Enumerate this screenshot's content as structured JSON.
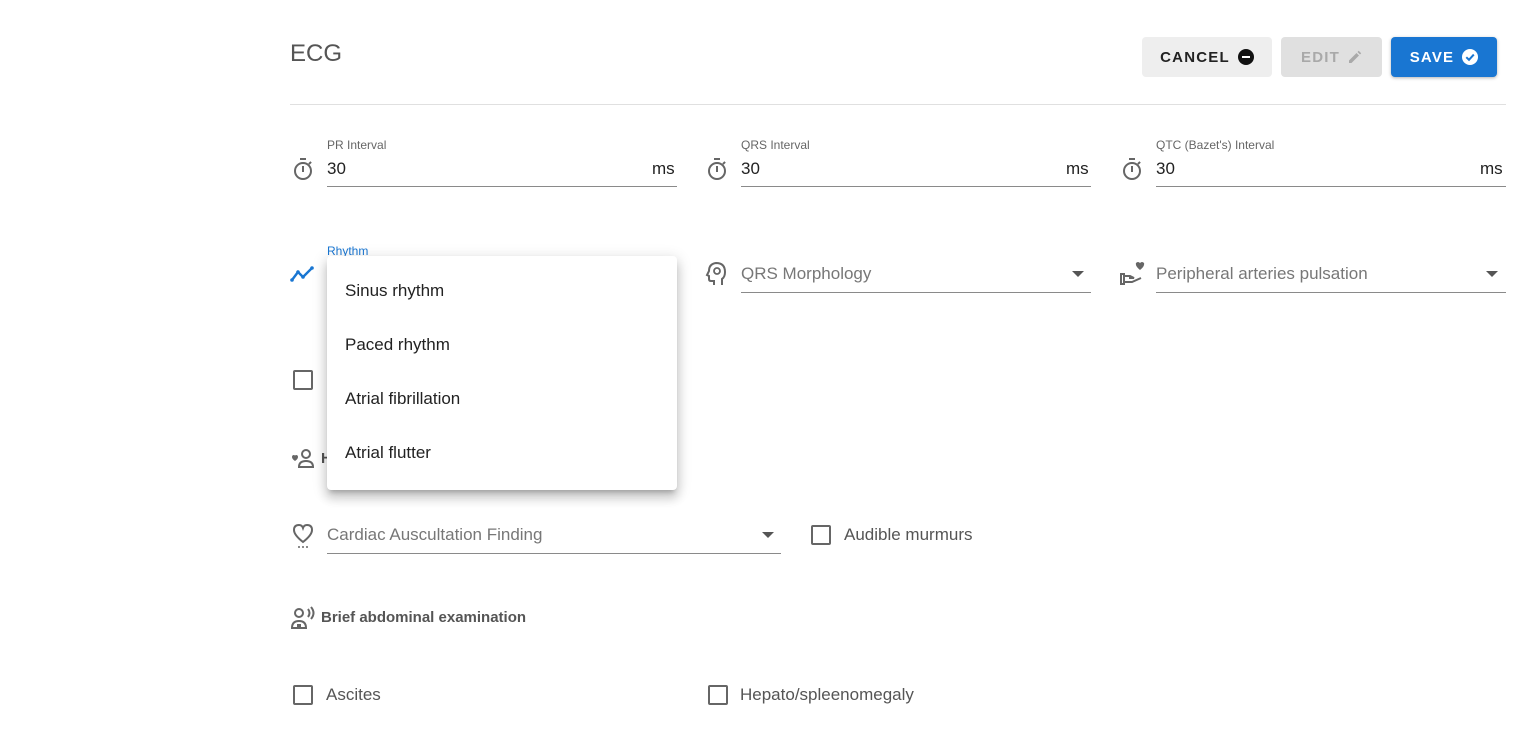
{
  "header": {
    "title": "ECG",
    "cancel_label": "CANCEL",
    "edit_label": "EDIT",
    "save_label": "SAVE"
  },
  "intervals": [
    {
      "label": "PR Interval",
      "value": "30",
      "unit": "ms"
    },
    {
      "label": "QRS Interval",
      "value": "30",
      "unit": "ms"
    },
    {
      "label": "QTC (Bazet's) Interval",
      "value": "30",
      "unit": "ms"
    }
  ],
  "rhythm": {
    "label": "Rhythm",
    "options": [
      "Sinus rhythm",
      "Paced rhythm",
      "Atrial fibrillation",
      "Atrial flutter"
    ]
  },
  "qrs_morphology": {
    "placeholder": "QRS Morphology"
  },
  "peripheral": {
    "placeholder": "Peripheral arteries pulsation"
  },
  "partial_section_initial": "H",
  "cardiac": {
    "placeholder": "Cardiac Auscultation Finding",
    "murmurs_label": "Audible murmurs"
  },
  "abdominal": {
    "title": "Brief abdominal examination",
    "ascites_label": "Ascites",
    "hepato_label": "Hepato/spleenomegaly"
  },
  "colors": {
    "primary": "#1976d2",
    "text": "#222222",
    "muted": "#777777"
  }
}
